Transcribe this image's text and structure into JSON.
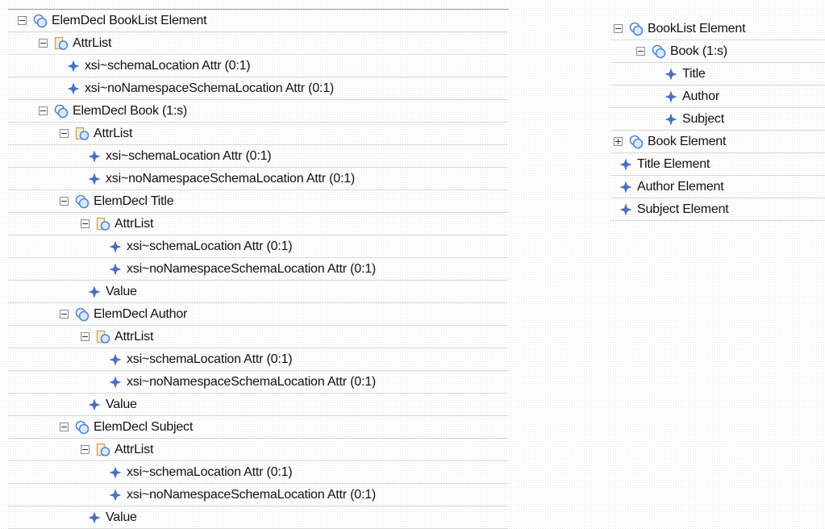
{
  "left_tree": [
    {
      "label": "ElemDecl BookList Element",
      "kind": "element",
      "level": 0,
      "toggle": "collapse"
    },
    {
      "label": "AttrList",
      "kind": "attrlist",
      "level": 1,
      "toggle": "collapse"
    },
    {
      "label": "xsi~schemaLocation Attr (0:1)",
      "kind": "leaf",
      "level": 2,
      "toggle": "none"
    },
    {
      "label": "xsi~noNamespaceSchemaLocation Attr (0:1)",
      "kind": "leaf",
      "level": 2,
      "toggle": "none"
    },
    {
      "label": "ElemDecl Book (1:s)",
      "kind": "element",
      "level": 1,
      "toggle": "collapse"
    },
    {
      "label": "AttrList",
      "kind": "attrlist",
      "level": 2,
      "toggle": "collapse"
    },
    {
      "label": "xsi~schemaLocation Attr (0:1)",
      "kind": "leaf",
      "level": 3,
      "toggle": "none"
    },
    {
      "label": "xsi~noNamespaceSchemaLocation Attr (0:1)",
      "kind": "leaf",
      "level": 3,
      "toggle": "none"
    },
    {
      "label": "ElemDecl Title",
      "kind": "element",
      "level": 2,
      "toggle": "collapse"
    },
    {
      "label": "AttrList",
      "kind": "attrlist",
      "level": 3,
      "toggle": "collapse"
    },
    {
      "label": "xsi~schemaLocation Attr (0:1)",
      "kind": "leaf",
      "level": 4,
      "toggle": "none"
    },
    {
      "label": "xsi~noNamespaceSchemaLocation Attr (0:1)",
      "kind": "leaf",
      "level": 4,
      "toggle": "none"
    },
    {
      "label": "Value",
      "kind": "leaf",
      "level": 3,
      "toggle": "none"
    },
    {
      "label": "ElemDecl Author",
      "kind": "element",
      "level": 2,
      "toggle": "collapse"
    },
    {
      "label": "AttrList",
      "kind": "attrlist",
      "level": 3,
      "toggle": "collapse"
    },
    {
      "label": "xsi~schemaLocation Attr (0:1)",
      "kind": "leaf",
      "level": 4,
      "toggle": "none"
    },
    {
      "label": "xsi~noNamespaceSchemaLocation Attr (0:1)",
      "kind": "leaf",
      "level": 4,
      "toggle": "none"
    },
    {
      "label": "Value",
      "kind": "leaf",
      "level": 3,
      "toggle": "none"
    },
    {
      "label": "ElemDecl Subject",
      "kind": "element",
      "level": 2,
      "toggle": "collapse"
    },
    {
      "label": "AttrList",
      "kind": "attrlist",
      "level": 3,
      "toggle": "collapse"
    },
    {
      "label": "xsi~schemaLocation Attr (0:1)",
      "kind": "leaf",
      "level": 4,
      "toggle": "none"
    },
    {
      "label": "xsi~noNamespaceSchemaLocation Attr (0:1)",
      "kind": "leaf",
      "level": 4,
      "toggle": "none"
    },
    {
      "label": "Value",
      "kind": "leaf",
      "level": 3,
      "toggle": "none"
    }
  ],
  "right_tree": [
    {
      "label": "BookList Element",
      "kind": "element",
      "level": 0,
      "toggle": "collapse"
    },
    {
      "label": "Book (1:s)",
      "kind": "element",
      "level": 1,
      "toggle": "collapse"
    },
    {
      "label": "Title",
      "kind": "leaf",
      "level": 2,
      "toggle": "none"
    },
    {
      "label": "Author",
      "kind": "leaf",
      "level": 2,
      "toggle": "none"
    },
    {
      "label": "Subject",
      "kind": "leaf",
      "level": 2,
      "toggle": "none"
    },
    {
      "label": "Book Element",
      "kind": "element",
      "level": 0,
      "toggle": "expand"
    },
    {
      "label": "Title Element",
      "kind": "leaf",
      "level": 0,
      "toggle": "none"
    },
    {
      "label": "Author Element",
      "kind": "leaf",
      "level": 0,
      "toggle": "none"
    },
    {
      "label": "Subject Element",
      "kind": "leaf",
      "level": 0,
      "toggle": "none"
    }
  ],
  "icons": {
    "element": "element-node-icon",
    "attrlist": "attribute-list-icon",
    "leaf": "diamond-node-icon"
  },
  "colors": {
    "element_blue": "#4f86d6",
    "folder_tan": "#c8a96a",
    "diamond_blue": "#4a6fc2"
  }
}
